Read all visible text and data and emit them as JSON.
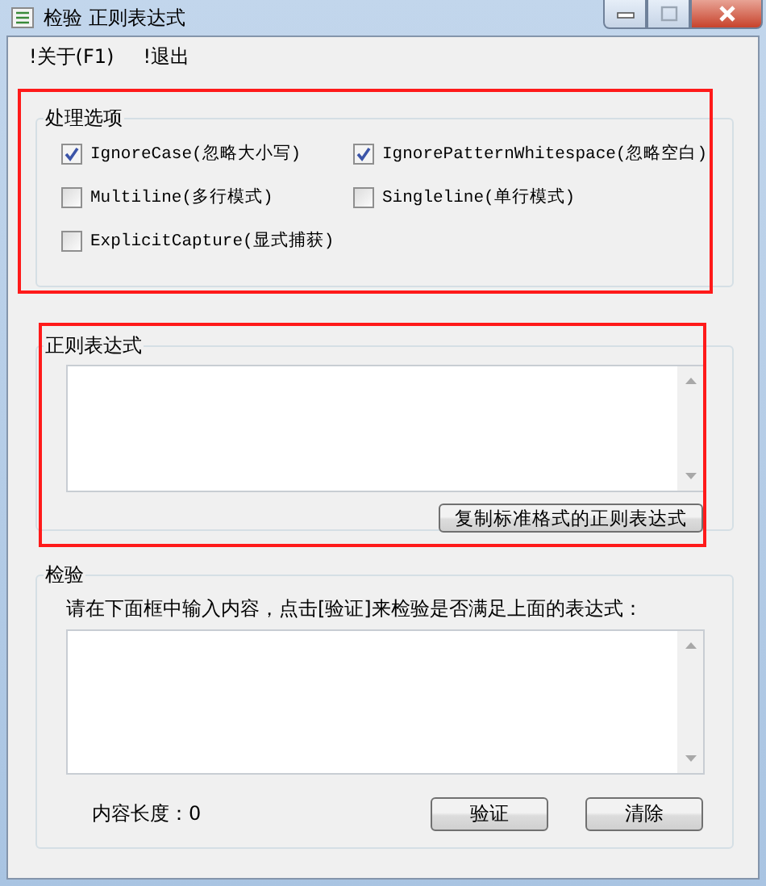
{
  "window": {
    "title": "检验 正则表达式"
  },
  "menu": [
    "!关于(F1)",
    "!退出"
  ],
  "options_group": {
    "title": "处理选项",
    "options": [
      {
        "label": "IgnoreCase(忽略大小写)",
        "checked": true
      },
      {
        "label": "IgnorePatternWhitespace(忽略空白)",
        "checked": true
      },
      {
        "label": "Multiline(多行模式)",
        "checked": false
      },
      {
        "label": "Singleline(单行模式)",
        "checked": false
      },
      {
        "label": "ExplicitCapture(显式捕获)",
        "checked": false
      }
    ]
  },
  "regex_group": {
    "title": "正则表达式",
    "copy_button": "复制标准格式的正则表达式"
  },
  "test_group": {
    "title": "检验",
    "instruction": "请在下面框中输入内容，点击[验证]来检验是否满足上面的表达式：",
    "length_label": "内容长度：0",
    "buttons": [
      "验证",
      "清除"
    ]
  }
}
